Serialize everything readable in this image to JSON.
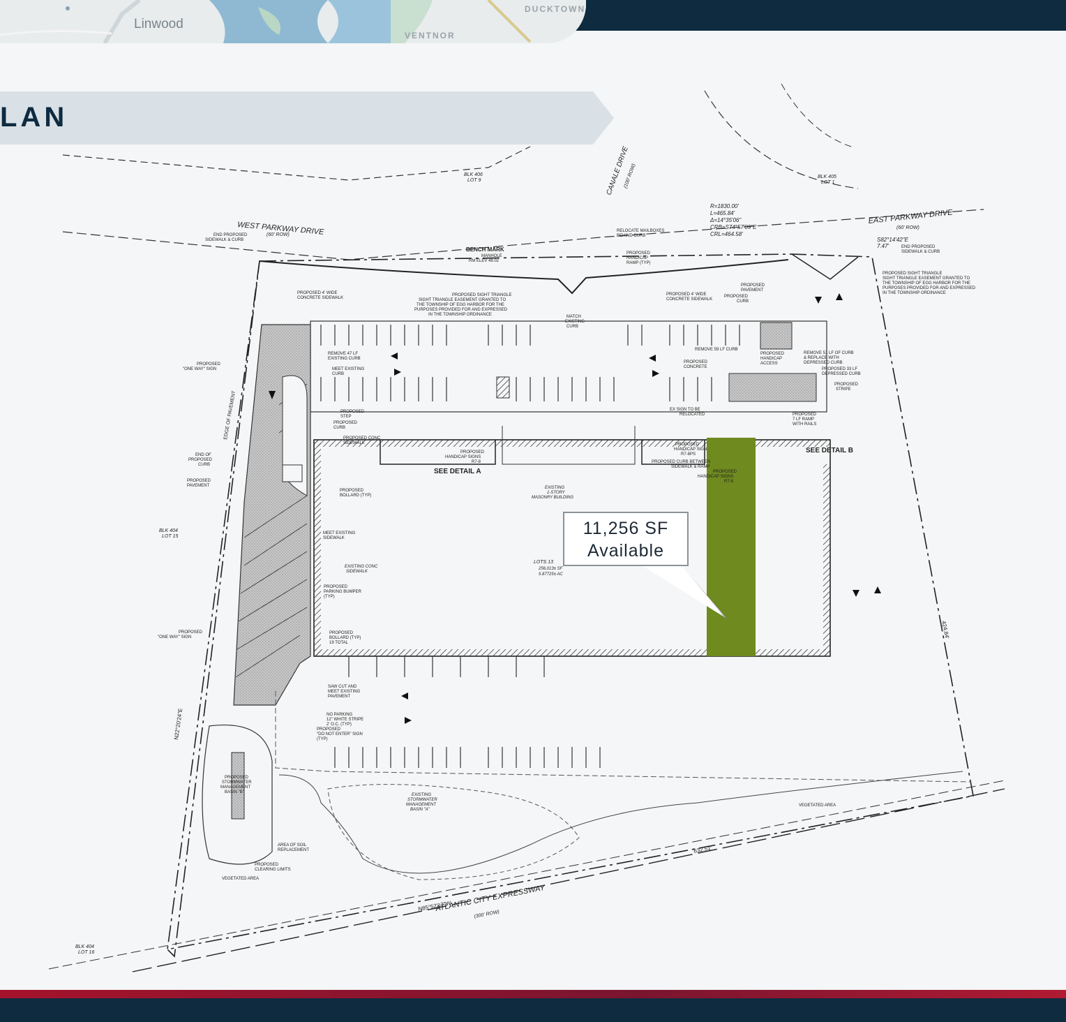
{
  "header": {
    "map_labels": {
      "town": "Linwood",
      "area_1": "DUCKTOWN",
      "area_2": "VENTNOR"
    }
  },
  "banner": {
    "title_fragment": "LAN"
  },
  "site_plan": {
    "roads": {
      "west": "WEST PARKWAY DRIVE",
      "west_row": "(60' ROW)",
      "east": "EAST PARKWAY DRIVE",
      "east_row": "(60' ROW)",
      "canale": "CANALE DRIVE",
      "canale_row": "(100' ROW)",
      "expressway": "ATLANTIC CITY EXPRESSWAY",
      "expressway_row": "(300' ROW)",
      "expressway_bearing": "N85°52'17\"W"
    },
    "parcels": {
      "blk406": "BLK 406",
      "blk406_lot": "LOT 9",
      "blk405": "BLK 405",
      "blk405_lot": "LOT 1",
      "blk404_15": "BLK 404",
      "blk404_15_lot": "LOT 15",
      "blk404_16": "BLK 404",
      "blk404_16_lot": "LOT 16"
    },
    "curve_data": {
      "r": "R=1830.00'",
      "l": "L=465.84'",
      "delta": "Δ=14°35'06\"",
      "crb": "CRB=S74°57'09\"E",
      "crl": "CRL=464.58'"
    },
    "dims": {
      "bottom": "632.51'",
      "right": "424.84'",
      "left_bearing": "N22°20'24\"E",
      "s82": "S82°14'42\"E",
      "s82_len": "7.47'"
    },
    "notes": {
      "bench_mark": "BENCH MARK",
      "manhole": "MANHOLE",
      "rim_elev": "RM ELEV 48.02",
      "building": "EXISTING",
      "building_2": "1-STORY",
      "building_3": "MASONRY BUILDING",
      "lots": "LOTS 13",
      "acres": "256,013± SF",
      "acres_2": "5.87725± AC",
      "see_a": "SEE DETAIL A",
      "see_b": "SEE DETAIL B",
      "basin_a": "EXISTING",
      "basin_a_2": "STORMWATER",
      "basin_a_3": "MANAGEMENT",
      "basin_a_4": "BASIN \"A\"",
      "basin_b": "PROPOSED",
      "basin_b_2": "STORMWATER",
      "basin_b_3": "MANAGEMENT",
      "basin_b_4": "BASIN \"B\"",
      "veg": "VEGETATED AREA",
      "veg_2": "VEGETATED AREA",
      "soil": "AREA OF SOIL",
      "soil_2": "REPLACEMENT",
      "clearing": "PROPOSED",
      "clearing_2": "CLEARING LIMITS",
      "sidewalk_4": "PROPOSED 4' WIDE",
      "sidewalk_4b": "CONCRETE SIDEWALK",
      "sidewalk_4c": "PROPOSED 4' WIDE",
      "sidewalk_4d": "CONCRETE SIDEWALK",
      "sight": "PROPOSED SIGHT TRIANGLE",
      "sight_2": "SIGHT TRIANGLE EASEMENT GRANTED TO",
      "sight_3": "THE TOWNSHIP OF EGG HARBOR FOR THE",
      "sight_4": "PURPOSES PROVIDED FOR AND EXPRESSED",
      "sight_5": "IN THE TOWNSHIP ORDINANCE",
      "sight_r": "PROPOSED SIGHT TRIANGLE",
      "sight_r2": "SIGHT TRIANGLE EASEMENT GRANTED TO",
      "sight_r3": "THE TOWNSHIP OF EGG HARBOR FOR THE",
      "sight_r4": "PURPOSES PROVIDED FOR AND EXPRESSED",
      "sight_r5": "IN THE TOWNSHIP ORDINANCE",
      "mailbox": "RELOCATE MAILBOXES",
      "mailbox_2": "BEHIND CURB",
      "hc_ramp": "PROPOSED",
      "hc_ramp_2": "HANDICAP",
      "hc_ramp_3": "RAMP (TYP)",
      "end_sw_l": "END PROPOSED",
      "end_sw_l2": "SIDEWALK & CURB",
      "end_sw_r": "END PROPOSED",
      "end_sw_r2": "SIDEWALK & CURB",
      "one_way": "PROPOSED",
      "one_way_2": "\"ONE WAY\" SIGN",
      "one_way_b": "PROPOSED",
      "one_way_b2": "\"ONE WAY\" SIGN",
      "end_curb": "END OF",
      "end_curb_2": "PROPOSED",
      "end_curb_3": "CURB",
      "prop_pav": "PROPOSED",
      "prop_pav_2": "PAVEMENT",
      "remove47": "REMOVE 47 LF",
      "remove47_2": "EXISTING CURB",
      "meet_curb": "MEET EXISTING",
      "meet_curb_2": "CURB",
      "step": "PROPOSED",
      "step_2": "STEP",
      "prop_curb": "PROPOSED",
      "prop_curb_2": "CURB",
      "conc_sw": "PROPOSED CONC",
      "conc_sw_2": "SIDEWALK",
      "bollard": "PROPOSED",
      "bollard_2": "BOLLARD (TYP)",
      "meet_sw": "MEET EXISTING",
      "meet_sw_2": "SIDEWALK",
      "ex_conc": "EXISTING CONC",
      "ex_conc_2": "SIDEWALK",
      "bumper": "PROPOSED",
      "bumper_2": "PARKING BUMPER",
      "bumper_3": "(TYP)",
      "bollard19": "PROPOSED",
      "bollard19_2": "BOLLARD (TYP)",
      "bollard19_3": "19 TOTAL",
      "sawcut": "SAW CUT AND",
      "sawcut_2": "MEET EXISTING",
      "sawcut_3": "PAVEMENT",
      "noparking": "NO PARKING",
      "noparking_2": "12\" WHITE STRIPE",
      "noparking_3": "2' O.C. (TYP)",
      "noparking_4": "PROPOSED",
      "noparking_5": "\"DO NOT ENTER\" SIGN",
      "noparking_6": "(TYP)",
      "hc_signs": "PROPOSED",
      "hc_signs_2": "HANDICAP SIGNS",
      "hc_signs_3": "R7-8",
      "remove59": "REMOVE 59 LF CURB",
      "remove51": "REMOVE 51 LF OF CURB",
      "remove51_2": "& REPLACE WITH",
      "remove51_3": "DEPRESSED CURB",
      "depressed": "PROPOSED 33 LF",
      "depressed_2": "DEPRESSED CURB",
      "stripe": "PROPOSED",
      "stripe_2": "STRIPE",
      "ramp7": "PROPOSED",
      "ramp7_2": "7 LF RAMP",
      "ramp7_3": "WITH RAILS",
      "ex_sign": "EX SIGN TO BE",
      "ex_sign_2": "RELOCATED",
      "hc_sign_r": "PROPOSED",
      "hc_sign_r2": "HANDICAP SIGN",
      "hc_sign_r3": "R7-8PS",
      "curb_between": "PROPOSED CURB BETWEEN",
      "curb_between_2": "SIDEWALK & RAMP",
      "hc_signs_r": "PROPOSED",
      "hc_signs_r2": "HANDICAP SIGNS",
      "hc_signs_r3": "R7-8",
      "match": "MATCH",
      "match_2": "EXISTING",
      "match_3": "CURB",
      "prop_conc": "PROPOSED",
      "prop_conc_2": "CONCRETE",
      "prop_pav_r": "PROPOSED",
      "prop_pav_r2": "PAVEMENT",
      "prop_curb_r": "PROPOSED",
      "prop_curb_r2": "CURB",
      "hc_access": "PROPOSED",
      "hc_access_2": "HANDICAP",
      "hc_access_3": "ACCESS",
      "edge_pav": "EDGE OF PAVEMENT"
    }
  },
  "highlight": {
    "color": "#6f8a1f",
    "area": "11,256 SF",
    "status": "Available"
  }
}
